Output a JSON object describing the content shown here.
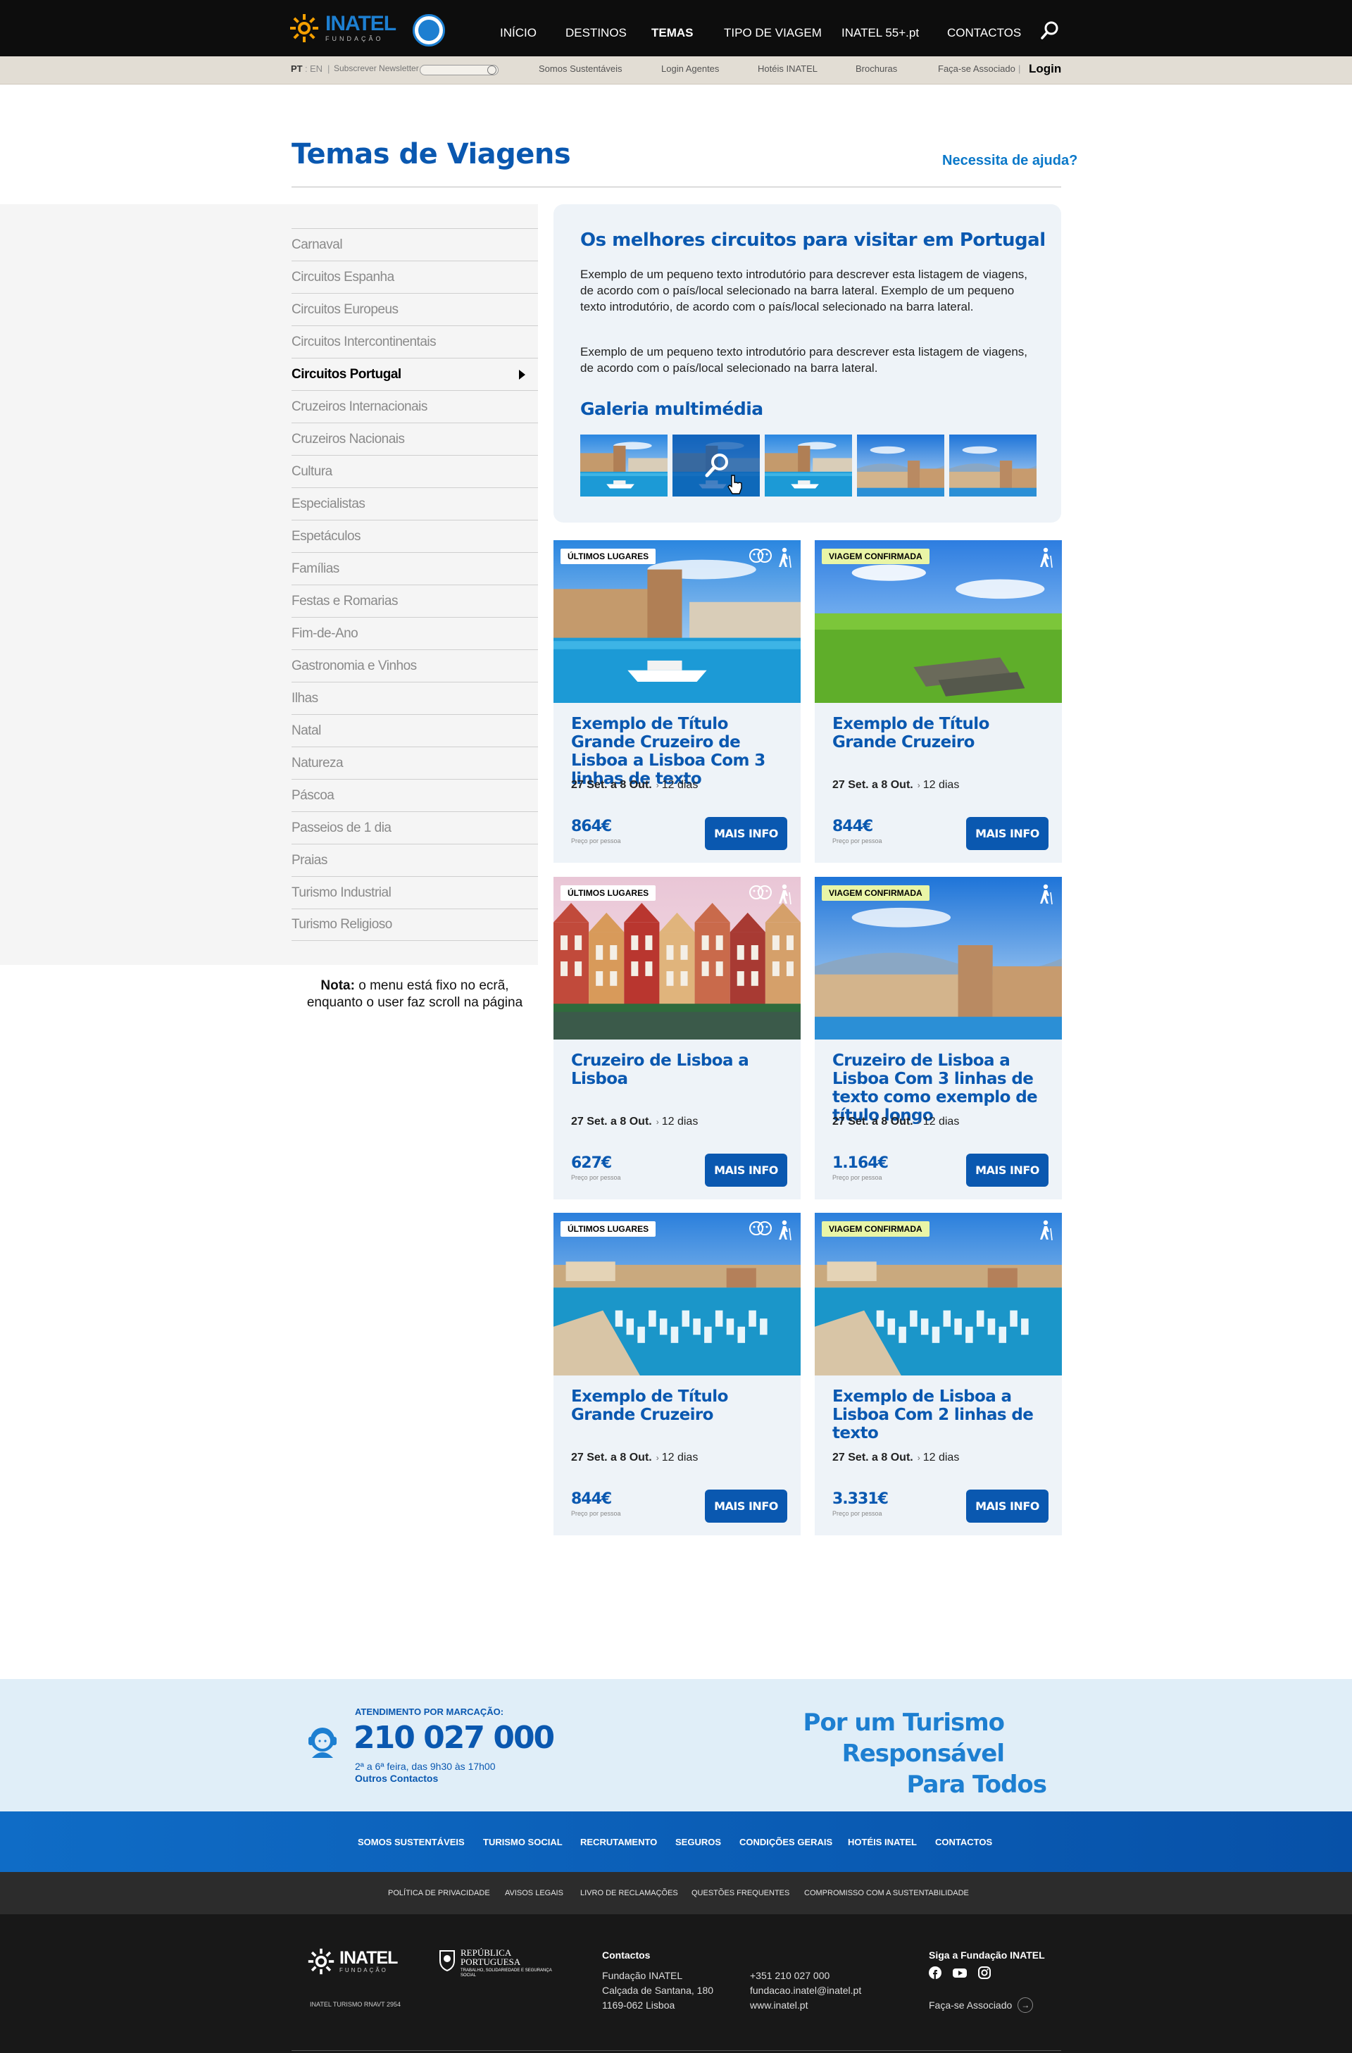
{
  "header": {
    "logo_text": "INATEL",
    "logo_sub": "FUNDAÇÃO",
    "nav": [
      {
        "label": "INÍCIO",
        "active": false
      },
      {
        "label": "DESTINOS",
        "active": false
      },
      {
        "label": "TEMAS",
        "active": true
      },
      {
        "label": "TIPO DE VIAGEM",
        "active": false
      },
      {
        "label": "INATEL 55+.pt",
        "active": false
      },
      {
        "label": "CONTACTOS",
        "active": false
      }
    ],
    "search_icon": "search-icon"
  },
  "subbar": {
    "lang_pt": "PT",
    "lang_en": "EN",
    "newsletter": "Subscrever Newsletter",
    "links": [
      "Somos Sustentáveis",
      "Login Agentes",
      "Hotéis INATEL",
      "Brochuras",
      "Faça-se Associado"
    ],
    "login": "Login"
  },
  "page": {
    "title": "Temas de Viagens",
    "help": "Necessita de ajuda?"
  },
  "sidebar": {
    "items": [
      "Carnaval",
      "Circuitos Espanha",
      "Circuitos Europeus",
      "Circuitos Intercontinentais",
      "Circuitos Portugal",
      "Cruzeiros Internacionais",
      "Cruzeiros Nacionais",
      "Cultura",
      "Especialistas",
      "Espetáculos",
      "Famílias",
      "Festas e Romarias",
      "Fim-de-Ano",
      "Gastronomia e Vinhos",
      "Ilhas",
      "Natal",
      "Natureza",
      "Páscoa",
      "Passeios de 1 dia",
      "Praias",
      "Turismo Industrial",
      "Turismo Religioso"
    ],
    "active_index": 4,
    "note_bold": "Nota:",
    "note_text": " o menu está fixo no ecrã, enquanto o user faz scroll na página"
  },
  "intro": {
    "title": "Os melhores circuitos para visitar em Portugal",
    "p1": "Exemplo de um pequeno texto introdutório para descrever esta listagem de viagens, de acordo com o país/local selecionado na barra lateral. Exemplo de um pequeno texto introdutório, de acordo com o país/local selecionado na barra lateral.",
    "p2": "Exemplo de um pequeno texto introdutório para descrever esta listagem de viagens, de acordo com o país/local selecionado na barra lateral.",
    "gallery_title": "Galeria multimédia"
  },
  "cards": [
    {
      "tag": "ÚLTIMOS LUGARES",
      "tag_style": "white",
      "title": "Exemplo de Título Grande Cruzeiro de Lisboa a Lisboa Com 3 linhas de texto",
      "dates": "27 Set. a 8 Out.",
      "days": "12 dias",
      "price": "864€",
      "per_person": "Preço por pessoa",
      "button": "MAIS INFO",
      "scene": "harbor"
    },
    {
      "tag": "VIAGEM CONFIRMADA",
      "tag_style": "yellow",
      "title": "Exemplo de Título Grande Cruzeiro",
      "dates": "27 Set. a 8 Out.",
      "days": "12 dias",
      "price": "844€",
      "per_person": "Preço por pessoa",
      "button": "MAIS INFO",
      "scene": "meadow"
    },
    {
      "tag": "ÚLTIMOS LUGARES",
      "tag_style": "white",
      "title": "Cruzeiro de Lisboa a Lisboa",
      "dates": "27 Set. a 8 Out.",
      "days": "12 dias",
      "price": "627€",
      "per_person": "Preço por pessoa",
      "button": "MAIS INFO",
      "scene": "houses"
    },
    {
      "tag": "VIAGEM CONFIRMADA",
      "tag_style": "yellow",
      "title": "Cruzeiro de Lisboa a Lisboa Com 3 linhas de texto como exemplo de título longo",
      "dates": "27 Set. a 8 Out.",
      "days": "12 dias",
      "price": "1.164€",
      "per_person": "Preço por pessoa",
      "button": "MAIS INFO",
      "scene": "fort"
    },
    {
      "tag": "ÚLTIMOS LUGARES",
      "tag_style": "white",
      "title": "Exemplo de Título Grande Cruzeiro",
      "dates": "27 Set. a 8 Out.",
      "days": "12 dias",
      "price": "844€",
      "per_person": "Preço por pessoa",
      "button": "MAIS INFO",
      "scene": "marina"
    },
    {
      "tag": "VIAGEM CONFIRMADA",
      "tag_style": "yellow",
      "title": "Exemplo de Lisboa a Lisboa Com 2 linhas de texto",
      "dates": "27 Set. a 8 Out.",
      "days": "12 dias",
      "price": "3.331€",
      "per_person": "Preço por pessoa",
      "button": "MAIS INFO",
      "scene": "marina"
    }
  ],
  "contact": {
    "label": "ATENDIMENTO POR MARCAÇÃO:",
    "phone": "210 027 000",
    "hours": "2ª a 6ª feira, das 9h30 às 17h00",
    "other": "Outros Contactos",
    "slogan_l1": "Por um Turismo Responsável",
    "slogan_l2": "Para Todos"
  },
  "footer_nav": [
    "SOMOS SUSTENTÁVEIS",
    "TURISMO SOCIAL",
    "RECRUTAMENTO",
    "SEGUROS",
    "CONDIÇÕES GERAIS",
    "HOTÉIS INATEL",
    "CONTACTOS"
  ],
  "legal_nav": [
    "POLÍTICA DE PRIVACIDADE",
    "AVISOS LEGAIS",
    "LIVRO DE RECLAMAÇÕES",
    "QUESTÕES FREQUENTES",
    "COMPROMISSO COM A SUSTENTABILIDADE"
  ],
  "footer": {
    "logo_text": "INATEL",
    "logo_sub": "FUNDAÇÃO",
    "rnavt": "INATEL TURISMO RNAVT 2954",
    "rep_l1": "REPÚBLICA",
    "rep_l2": "PORTUGUESA",
    "rep_sub": "TRABALHO, SOLIDARIEDADE E SEGURANÇA SOCIAL",
    "contacts_title": "Contactos",
    "addr1": "Fundação INATEL",
    "addr2": "Calçada de Santana, 180",
    "addr3": "1169-062 Lisboa",
    "phone": "+351 210 027 000",
    "email": "fundacao.inatel@inatel.pt",
    "web": "www.inatel.pt",
    "follow": "Siga a Fundação INATEL",
    "social": [
      "facebook-icon",
      "youtube-icon",
      "instagram-icon"
    ],
    "associado": "Faça-se Associado"
  },
  "colors": {
    "primary": "#0a58b0",
    "accent": "#1d7fd1",
    "header_bg": "#0d0d0d",
    "card_bg": "#eef3f8",
    "tag_yellow": "#e9f5a6"
  }
}
